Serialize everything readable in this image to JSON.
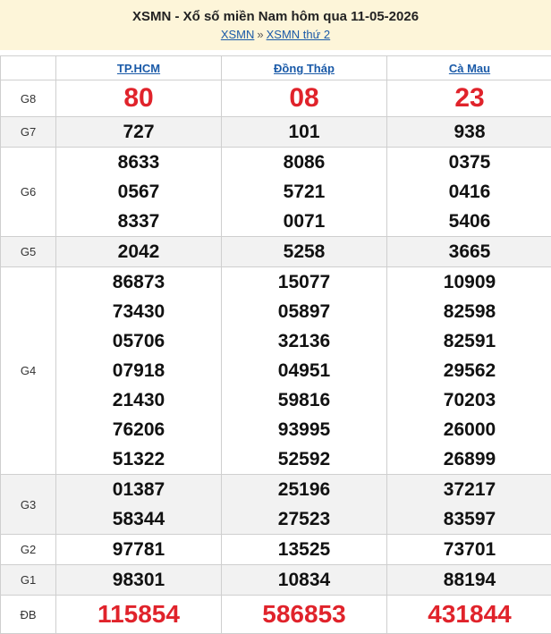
{
  "header": {
    "title": "XSMN - Xổ số miền Nam hôm qua 11-05-2026",
    "crumb_1": "XSMN",
    "crumb_sep": "»",
    "crumb_2": "XSMN thứ 2"
  },
  "provinces": [
    "TP.HCM",
    "Đồng Tháp",
    "Cà Mau"
  ],
  "prizes": [
    {
      "label": "G8",
      "values": [
        [
          "80"
        ],
        [
          "08"
        ],
        [
          "23"
        ]
      ]
    },
    {
      "label": "G7",
      "values": [
        [
          "727"
        ],
        [
          "101"
        ],
        [
          "938"
        ]
      ]
    },
    {
      "label": "G6",
      "values": [
        [
          "8633",
          "0567",
          "8337"
        ],
        [
          "8086",
          "5721",
          "0071"
        ],
        [
          "0375",
          "0416",
          "5406"
        ]
      ]
    },
    {
      "label": "G5",
      "values": [
        [
          "2042"
        ],
        [
          "5258"
        ],
        [
          "3665"
        ]
      ]
    },
    {
      "label": "G4",
      "values": [
        [
          "86873",
          "73430",
          "05706",
          "07918",
          "21430",
          "76206",
          "51322"
        ],
        [
          "15077",
          "05897",
          "32136",
          "04951",
          "59816",
          "93995",
          "52592"
        ],
        [
          "10909",
          "82598",
          "82591",
          "29562",
          "70203",
          "26000",
          "26899"
        ]
      ]
    },
    {
      "label": "G3",
      "values": [
        [
          "01387",
          "58344"
        ],
        [
          "25196",
          "27523"
        ],
        [
          "37217",
          "83597"
        ]
      ]
    },
    {
      "label": "G2",
      "values": [
        [
          "97781"
        ],
        [
          "13525"
        ],
        [
          "73701"
        ]
      ]
    },
    {
      "label": "G1",
      "values": [
        [
          "98301"
        ],
        [
          "10834"
        ],
        [
          "88194"
        ]
      ]
    },
    {
      "label": "ĐB",
      "values": [
        [
          "115854"
        ],
        [
          "586853"
        ],
        [
          "431844"
        ]
      ]
    }
  ],
  "colors": {
    "accent_red": "#e0232b",
    "link_blue": "#1a5aa8",
    "header_bg": "#fdf5d9"
  }
}
